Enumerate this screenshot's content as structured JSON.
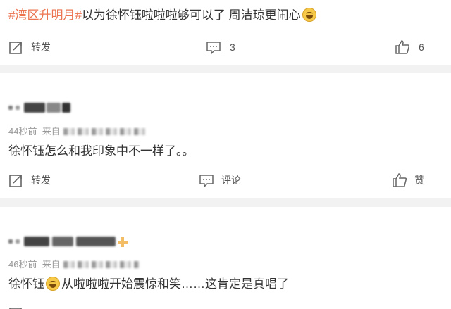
{
  "post": {
    "hashtag": "#湾区升明月#",
    "text": "以为徐怀钰啦啦啦够可以了 周洁琼更闹心",
    "emoji_icon": "laughing-crying-emoji"
  },
  "post_actions": {
    "repost_label": "转发",
    "comment_count": "3",
    "like_count": "6"
  },
  "comments": [
    {
      "time": "44秒前",
      "source_prefix": "来自",
      "text": "徐怀钰怎么和我印象中不一样了。。",
      "actions": {
        "repost_label": "转发",
        "comment_label": "评论",
        "like_label": "赞"
      }
    },
    {
      "time": "46秒前",
      "source_prefix": "来自",
      "text_before": "徐怀钰",
      "emoji_icon": "grinning-emoji",
      "text_after": "从啦啦啦开始震惊和笑……这肯定是真唱了"
    }
  ],
  "colors": {
    "hashtag": "#eb7350",
    "separator": "#f2f2f2",
    "meta": "#999999"
  }
}
